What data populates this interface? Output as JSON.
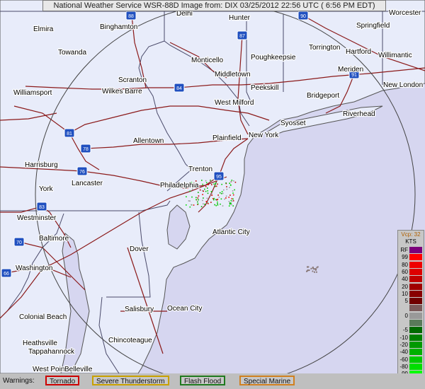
{
  "title": "National Weather Service WSR-88D Image from: DIX 03/25/2012 22:56 UTC ( 6:56 PM EDT)",
  "colors": {
    "land": "#e8ecfa",
    "ocean": "#d6d6f0",
    "highway": "#8b1a1a",
    "state_border": "#4a4a6a",
    "coast": "#555555",
    "range_ring": "#444444"
  },
  "cities": [
    {
      "name": "Elmira"
    },
    {
      "name": "Binghamton"
    },
    {
      "name": "Delhi"
    },
    {
      "name": "Hunter"
    },
    {
      "name": "Worcester"
    },
    {
      "name": "Springfield"
    },
    {
      "name": "Torrington"
    },
    {
      "name": "Hartford"
    },
    {
      "name": "Willimantic"
    },
    {
      "name": "Towanda"
    },
    {
      "name": "Monticello"
    },
    {
      "name": "Poughkeepsie"
    },
    {
      "name": "Meriden"
    },
    {
      "name": "New London"
    },
    {
      "name": "Middletown"
    },
    {
      "name": "Scranton"
    },
    {
      "name": "Wilkes Barre"
    },
    {
      "name": "Peekskill"
    },
    {
      "name": "Williamsport"
    },
    {
      "name": "Bridgeport"
    },
    {
      "name": "West Milford"
    },
    {
      "name": "Riverhead"
    },
    {
      "name": "Syosset"
    },
    {
      "name": "New York"
    },
    {
      "name": "Plainfield"
    },
    {
      "name": "Allentown"
    },
    {
      "name": "Trenton"
    },
    {
      "name": "Harrisburg"
    },
    {
      "name": "Philadelphia"
    },
    {
      "name": "Lancaster"
    },
    {
      "name": "York"
    },
    {
      "name": "Westminster"
    },
    {
      "name": "Atlantic City"
    },
    {
      "name": "Baltimore"
    },
    {
      "name": "Dover"
    },
    {
      "name": "Washington"
    },
    {
      "name": "Salisbury"
    },
    {
      "name": "Ocean City"
    },
    {
      "name": "Colonial Beach"
    },
    {
      "name": "Chincoteague"
    },
    {
      "name": "Heathsville"
    },
    {
      "name": "Tappahannock"
    },
    {
      "name": "West Point"
    },
    {
      "name": "Belleville"
    }
  ],
  "interstates": [
    "88",
    "90",
    "87",
    "84",
    "81",
    "78",
    "76",
    "83",
    "70",
    "66",
    "95",
    "91"
  ],
  "legend": {
    "mode": "Vcp: 32",
    "units": "KTS",
    "entries": [
      {
        "label": "RF",
        "color": "#7b007b"
      },
      {
        "label": "99",
        "color": "#ff0000"
      },
      {
        "label": "80",
        "color": "#ee0000"
      },
      {
        "label": "60",
        "color": "#dd0000"
      },
      {
        "label": "40",
        "color": "#c00000"
      },
      {
        "label": "20",
        "color": "#a00000"
      },
      {
        "label": "10",
        "color": "#880000"
      },
      {
        "label": "5",
        "color": "#700000"
      },
      {
        "label": "",
        "color": "#7a5a5a"
      },
      {
        "label": "0",
        "color": "#999999"
      },
      {
        "label": "",
        "color": "#5a7a5a"
      },
      {
        "label": "-5",
        "color": "#006a00"
      },
      {
        "label": "-10",
        "color": "#008000"
      },
      {
        "label": "-20",
        "color": "#009900"
      },
      {
        "label": "-40",
        "color": "#00b000"
      },
      {
        "label": "-60",
        "color": "#00c800"
      },
      {
        "label": "-80",
        "color": "#00de00"
      },
      {
        "label": "-99",
        "color": "#00ff00"
      },
      {
        "label": "ND",
        "color": "#000000"
      }
    ]
  },
  "warnings": {
    "label": "Warnings:",
    "items": [
      {
        "name": "Tornado",
        "color": "#cc0000"
      },
      {
        "name": "Severe Thunderstorm",
        "color": "#c8a000"
      },
      {
        "name": "Flash Flood",
        "color": "#1f7a1f"
      },
      {
        "name": "Special Marine",
        "color": "#d08020"
      }
    ]
  }
}
